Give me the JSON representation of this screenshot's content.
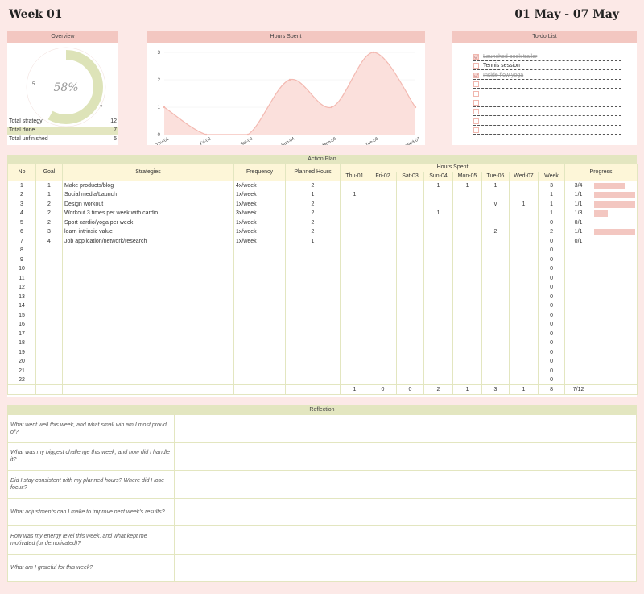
{
  "header": {
    "title": "Week 01",
    "date_range": "01 May - 07 May"
  },
  "overview": {
    "title": "Overview",
    "percent": "58%",
    "percent_value": 58,
    "ring_left": "5",
    "ring_right": "7",
    "rows": [
      {
        "label": "Total strategy",
        "value": "12"
      },
      {
        "label": "Total done",
        "value": "7"
      },
      {
        "label": "Total unfinished",
        "value": "5"
      }
    ]
  },
  "hours_chart": {
    "title": "Hours Spent",
    "chart_data": {
      "type": "area",
      "categories": [
        "Thu-01",
        "Fri-02",
        "Sat-03",
        "Sun-04",
        "Mon-05",
        "Tue-06",
        "Wed-07"
      ],
      "values": [
        1,
        0,
        0,
        2,
        1,
        3,
        1
      ],
      "yticks": [
        "0",
        "1",
        "2",
        "3"
      ],
      "ylim": [
        0,
        3
      ]
    }
  },
  "todo": {
    "title": "To-do List",
    "items": [
      {
        "text": "Launched book trailer",
        "checked": true
      },
      {
        "text": "Tennis session",
        "checked": false
      },
      {
        "text": "Inside flow yoga",
        "checked": true
      },
      {
        "text": "",
        "checked": false
      },
      {
        "text": "",
        "checked": false
      },
      {
        "text": "",
        "checked": false
      },
      {
        "text": "",
        "checked": false
      },
      {
        "text": "",
        "checked": false
      },
      {
        "text": "",
        "checked": false
      }
    ]
  },
  "action_plan": {
    "title": "Action Plan",
    "headers": {
      "no": "No",
      "goal": "Goal",
      "strategies": "Strategies",
      "frequency": "Frequency",
      "planned": "Planned Hours",
      "hours_spent": "Hours Spent",
      "week": "Week",
      "progress": "Progress"
    },
    "days": [
      "Thu-01",
      "Fri-02",
      "Sat-03",
      "Sun-04",
      "Mon-05",
      "Tue-06",
      "Wed-07"
    ],
    "rows": [
      {
        "no": "1",
        "goal": "1",
        "strategy": "Make products/blog",
        "freq": "4x/week",
        "planned": "2",
        "days": [
          "",
          "",
          "",
          "1",
          "1",
          "1",
          ""
        ],
        "week": "3",
        "progress": "3/4",
        "bar": 0.75
      },
      {
        "no": "2",
        "goal": "1",
        "strategy": "Social media/Launch",
        "freq": "1x/week",
        "planned": "1",
        "days": [
          "1",
          "",
          "",
          "",
          "",
          "",
          ""
        ],
        "week": "1",
        "progress": "1/1",
        "bar": 1
      },
      {
        "no": "3",
        "goal": "2",
        "strategy": "Design workout",
        "freq": "1x/week",
        "planned": "2",
        "days": [
          "",
          "",
          "",
          "",
          "",
          "v",
          "1"
        ],
        "week": "1",
        "progress": "1/1",
        "bar": 1
      },
      {
        "no": "4",
        "goal": "2",
        "strategy": "Workout 3 times per week with cardio",
        "freq": "3x/week",
        "planned": "2",
        "days": [
          "",
          "",
          "",
          "1",
          "",
          "",
          ""
        ],
        "week": "1",
        "progress": "1/3",
        "bar": 0.33
      },
      {
        "no": "5",
        "goal": "2",
        "strategy": "Sport cardio/yoga per week",
        "freq": "1x/week",
        "planned": "2",
        "days": [
          "",
          "",
          "",
          "",
          "",
          "",
          ""
        ],
        "week": "0",
        "progress": "0/1",
        "bar": 0
      },
      {
        "no": "6",
        "goal": "3",
        "strategy": "learn intrinsic value",
        "freq": "1x/week",
        "planned": "2",
        "days": [
          "",
          "",
          "",
          "",
          "",
          "2",
          ""
        ],
        "week": "2",
        "progress": "1/1",
        "bar": 1
      },
      {
        "no": "7",
        "goal": "4",
        "strategy": "Job application/network/research",
        "freq": "1x/week",
        "planned": "1",
        "days": [
          "",
          "",
          "",
          "",
          "",
          "",
          ""
        ],
        "week": "0",
        "progress": "0/1",
        "bar": 0
      },
      {
        "no": "8",
        "week": "0"
      },
      {
        "no": "9",
        "week": "0"
      },
      {
        "no": "10",
        "week": "0"
      },
      {
        "no": "11",
        "week": "0"
      },
      {
        "no": "12",
        "week": "0"
      },
      {
        "no": "13",
        "week": "0"
      },
      {
        "no": "14",
        "week": "0"
      },
      {
        "no": "15",
        "week": "0"
      },
      {
        "no": "16",
        "week": "0"
      },
      {
        "no": "17",
        "week": "0"
      },
      {
        "no": "18",
        "week": "0"
      },
      {
        "no": "19",
        "week": "0"
      },
      {
        "no": "20",
        "week": "0"
      },
      {
        "no": "21",
        "week": "0"
      },
      {
        "no": "22",
        "week": "0"
      }
    ],
    "totals": {
      "days": [
        "1",
        "0",
        "0",
        "2",
        "1",
        "3",
        "1"
      ],
      "week": "8",
      "progress": "7/12"
    }
  },
  "reflection": {
    "title": "Reflection",
    "questions": [
      "What went well this week, and what small win am I most proud of?",
      "What was my biggest challenge this week, and how did I handle it?",
      "Did I stay consistent with my planned hours? Where did I lose focus?",
      "What adjustments can I make to improve next week's results?",
      "How was my energy level this week, and what kept me motivated (or demotivated)?",
      "What am I grateful for this week?"
    ]
  }
}
